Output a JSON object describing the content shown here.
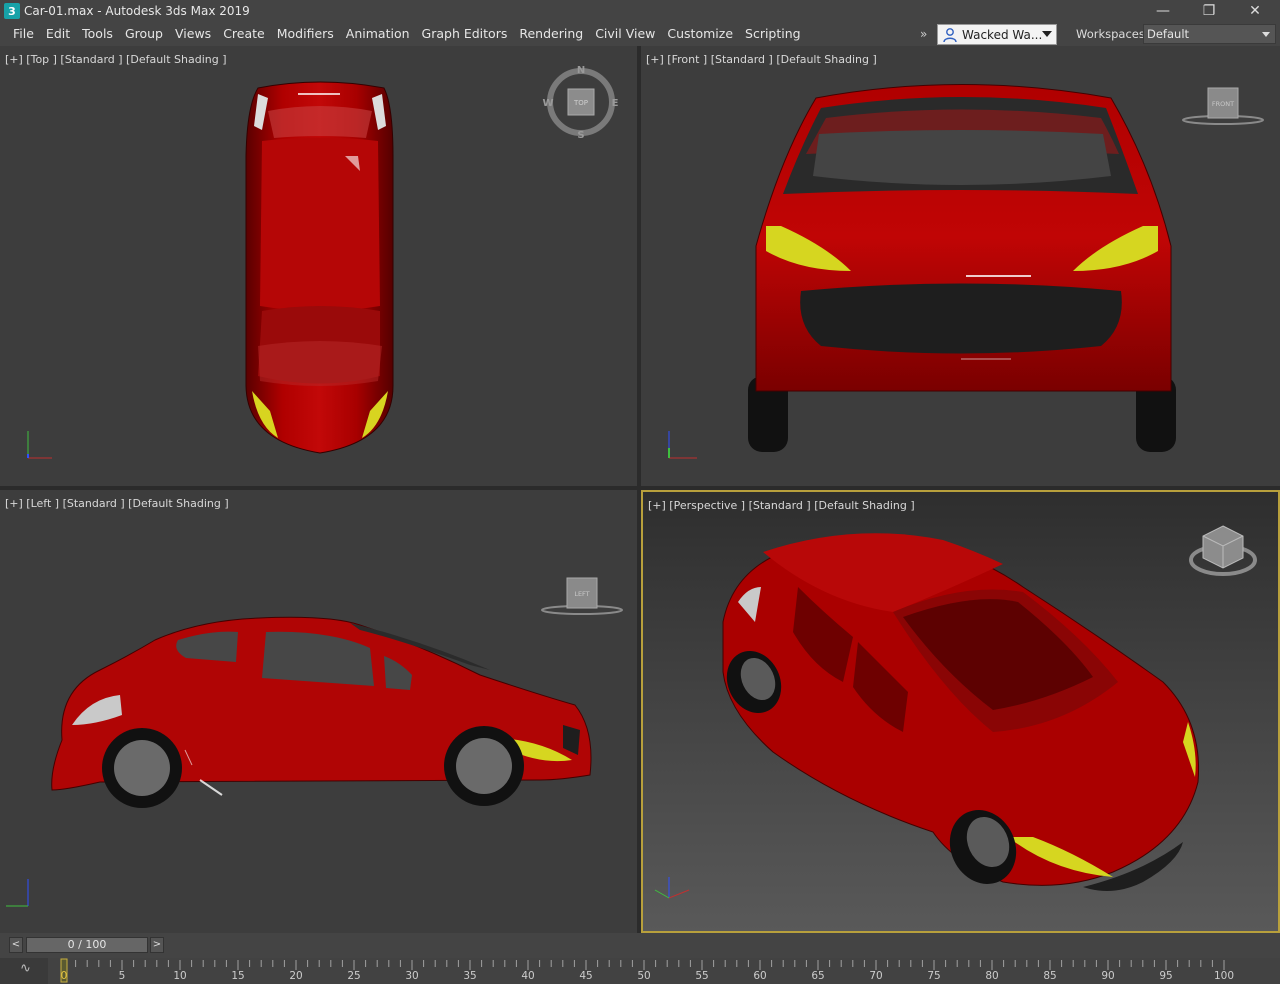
{
  "window": {
    "title": "Car-01.max - Autodesk 3ds Max 2019",
    "app_icon": "3",
    "controls": {
      "minimize": "—",
      "restore": "❐",
      "close": "✕"
    }
  },
  "menu": {
    "items": [
      {
        "label": "File"
      },
      {
        "label": "Edit"
      },
      {
        "label": "Tools"
      },
      {
        "label": "Group"
      },
      {
        "label": "Views"
      },
      {
        "label": "Create"
      },
      {
        "label": "Modifiers"
      },
      {
        "label": "Animation"
      },
      {
        "label": "Graph Editors"
      },
      {
        "label": "Rendering"
      },
      {
        "label": "Civil View"
      },
      {
        "label": "Customize"
      },
      {
        "label": "Scripting"
      }
    ],
    "overflow": "»",
    "user": "Wacked Wa...",
    "workspaces_label": "Workspaces:",
    "workspace": "Default"
  },
  "viewports": {
    "top": {
      "label": "[+] [Top ] [Standard ] [Default Shading ]",
      "cube": "TOP"
    },
    "front": {
      "label": "[+] [Front ] [Standard ] [Default Shading ]",
      "cube": "FRONT"
    },
    "left": {
      "label": "[+] [Left ] [Standard ] [Default Shading ]",
      "cube": "LEFT"
    },
    "perspective": {
      "label": "[+] [Perspective ] [Standard ] [Default Shading ]"
    }
  },
  "compass": {
    "n": "N",
    "s": "S",
    "e": "E",
    "w": "W"
  },
  "timeline": {
    "prev": "<",
    "next": ">",
    "frame": "0 / 100",
    "ticks": [
      "0",
      "5",
      "10",
      "15",
      "20",
      "25",
      "30",
      "35",
      "40",
      "45",
      "50",
      "55",
      "60",
      "65",
      "70",
      "75",
      "80",
      "85",
      "90",
      "95",
      "100"
    ]
  },
  "colors": {
    "car": "#a00000",
    "accent": "#b8a03c",
    "light": "#d6d620"
  }
}
